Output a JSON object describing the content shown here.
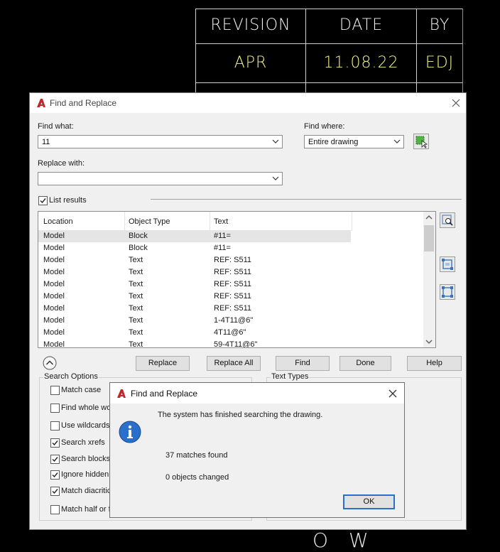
{
  "cad": {
    "header": {
      "revision": "REVISION",
      "date": "DATE",
      "by": "BY"
    },
    "row": {
      "revision": "APR",
      "date": "11.08.22",
      "by": "EDJ"
    },
    "bottom_text": "O W"
  },
  "find_dialog": {
    "title": "Find and Replace",
    "find_what_label": "Find what:",
    "find_what_value": "11",
    "find_where_label": "Find where:",
    "find_where_value": "Entire drawing",
    "replace_with_label": "Replace with:",
    "replace_with_value": "",
    "list_results_label": "List results",
    "list_results_checked": true,
    "columns": [
      "Location",
      "Object Type",
      "Text"
    ],
    "rows": [
      [
        "Model",
        "Block",
        "#11="
      ],
      [
        "Model",
        "Block",
        "#11="
      ],
      [
        "Model",
        "Text",
        "REF: S511"
      ],
      [
        "Model",
        "Text",
        "REF: S511"
      ],
      [
        "Model",
        "Text",
        "REF: S511"
      ],
      [
        "Model",
        "Text",
        "REF: S511"
      ],
      [
        "Model",
        "Text",
        "REF: S511"
      ],
      [
        "Model",
        "Text",
        "1-4T11@6\""
      ],
      [
        "Model",
        "Text",
        "4T11@6\""
      ],
      [
        "Model",
        "Text",
        "59-4T11@6\""
      ]
    ],
    "buttons": {
      "replace": "Replace",
      "replace_all": "Replace All",
      "find": "Find",
      "done": "Done",
      "help": "Help"
    },
    "search_options_label": "Search Options",
    "text_types_label": "Text Types",
    "options": [
      {
        "label": "Match case",
        "checked": false
      },
      {
        "label": "Find whole wo",
        "checked": false
      },
      {
        "label": "Use wildcards",
        "checked": false
      },
      {
        "label": "Search xrefs",
        "checked": true
      },
      {
        "label": "Search blocks",
        "checked": true
      },
      {
        "label": "Ignore hidden",
        "checked": true
      },
      {
        "label": "Match diacritic",
        "checked": true
      },
      {
        "label": "Match half or f",
        "checked": false
      }
    ]
  },
  "message_box": {
    "title": "Find and Replace",
    "message": "The system has finished searching the drawing.",
    "matches": "37 matches found",
    "changed": "0 objects changed",
    "ok": "OK"
  },
  "colors": {
    "autocad_red": "#c0272d",
    "info_blue": "#2a6fc9",
    "cad_yellow": "#f5f58a",
    "cad_cyan": "#3aaecd"
  }
}
